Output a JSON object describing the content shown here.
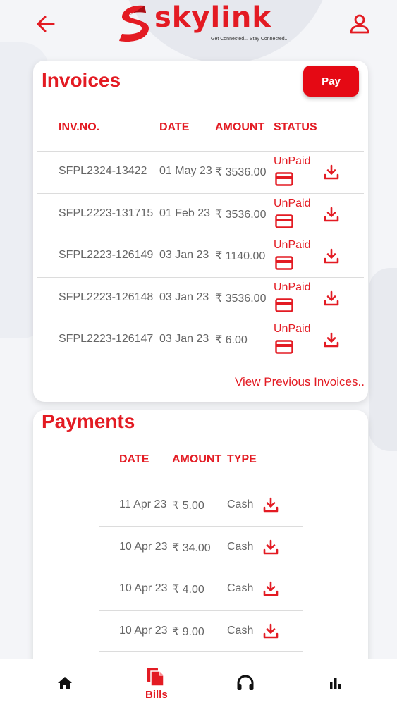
{
  "header": {
    "brand": "skylink",
    "tagline": "Get Connected... Stay Connected..."
  },
  "invoices": {
    "title": "Invoices",
    "pay_label": "Pay",
    "columns": [
      "INV.NO.",
      "DATE",
      "AMOUNT",
      "STATUS"
    ],
    "rows": [
      {
        "inv_no": "SFPL2324-13422",
        "date": "01 May 23",
        "amount": "₹ 3536.00",
        "status": "UnPaid"
      },
      {
        "inv_no": "SFPL2223-131715",
        "date": "01 Feb 23",
        "amount": "₹ 3536.00",
        "status": "UnPaid"
      },
      {
        "inv_no": "SFPL2223-126149",
        "date": "03 Jan 23",
        "amount": "₹ 1140.00",
        "status": "UnPaid"
      },
      {
        "inv_no": "SFPL2223-126148",
        "date": "03 Jan 23",
        "amount": "₹ 3536.00",
        "status": "UnPaid"
      },
      {
        "inv_no": "SFPL2223-126147",
        "date": "03 Jan 23",
        "amount": "₹ 6.00",
        "status": "UnPaid"
      }
    ],
    "view_previous": "View Previous Invoices.."
  },
  "payments": {
    "title": "Payments",
    "columns": [
      "DATE",
      "AMOUNT",
      "TYPE"
    ],
    "rows": [
      {
        "date": "11 Apr 23",
        "amount": "₹ 5.00",
        "type": "Cash"
      },
      {
        "date": "10 Apr 23",
        "amount": "₹ 34.00",
        "type": "Cash"
      },
      {
        "date": "10 Apr 23",
        "amount": "₹ 4.00",
        "type": "Cash"
      },
      {
        "date": "10 Apr 23",
        "amount": "₹ 9.00",
        "type": "Cash"
      }
    ]
  },
  "nav": {
    "active_label": "Bills",
    "items": [
      "home-icon",
      "bills-icon",
      "headset-icon",
      "chart-icon"
    ]
  },
  "colors": {
    "brand_red": "#e31b23",
    "pay_button": "#e50914"
  }
}
